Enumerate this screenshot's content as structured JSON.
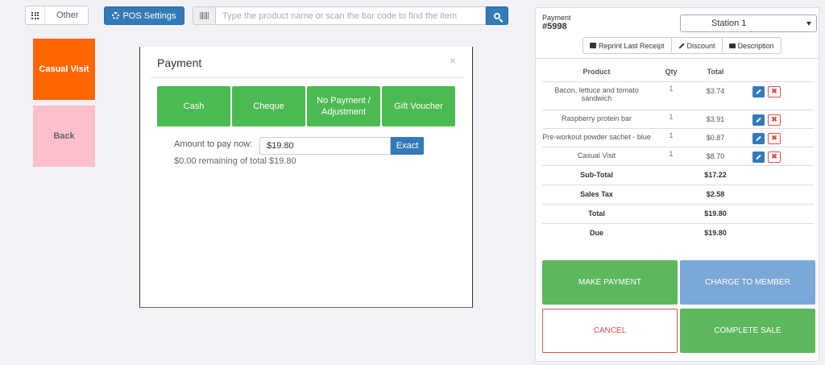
{
  "header": {
    "breadcrumb_label": "Other",
    "pos_settings_label": "POS Settings",
    "search_placeholder": "Type the product name or scan the bar code to find the item"
  },
  "tiles": {
    "casual_visit": "Casual Visit",
    "back": "Back"
  },
  "modal": {
    "title": "Payment",
    "close": "×",
    "options": [
      "Cash",
      "Cheque",
      "No Payment / Adjustment",
      "Gift Voucher"
    ],
    "amount_label": "Amount to pay now:",
    "amount_value": "$19.80",
    "exact_label": "Exact",
    "remaining_text": "$0.00 remaining of total $19.80"
  },
  "panel": {
    "label": "Payment",
    "number": "#5998",
    "station": "Station 1",
    "actions": [
      "Reprint Last Receipt",
      "Discount",
      "Description"
    ],
    "columns": [
      "Product",
      "Qty",
      "Total"
    ],
    "items": [
      {
        "product": "Bacon, lettuce and tomato sandwich",
        "qty": "1",
        "total": "$3.74"
      },
      {
        "product": "Raspberry protein bar",
        "qty": "1",
        "total": "$3.91"
      },
      {
        "product": "Pre-workout powder sachet - blue",
        "qty": "1",
        "total": "$0.87"
      },
      {
        "product": "Casual Visit",
        "qty": "1",
        "total": "$8.70"
      }
    ],
    "summary": [
      {
        "label": "Sub-Total",
        "value": "$17.22"
      },
      {
        "label": "Sales Tax",
        "value": "$2.58"
      },
      {
        "label": "Total",
        "value": "$19.80"
      },
      {
        "label": "Due",
        "value": "$19.80"
      }
    ],
    "buttons": {
      "make_payment": "MAKE PAYMENT",
      "charge_member": "CHARGE TO MEMBER",
      "cancel": "CANCEL",
      "complete_sale": "COMPLETE SALE"
    }
  },
  "colors": {
    "primary": "#337ab7",
    "green": "#5cb85c",
    "orange": "#ff6600",
    "pink": "#ffc0cb",
    "danger": "#d9534f"
  }
}
